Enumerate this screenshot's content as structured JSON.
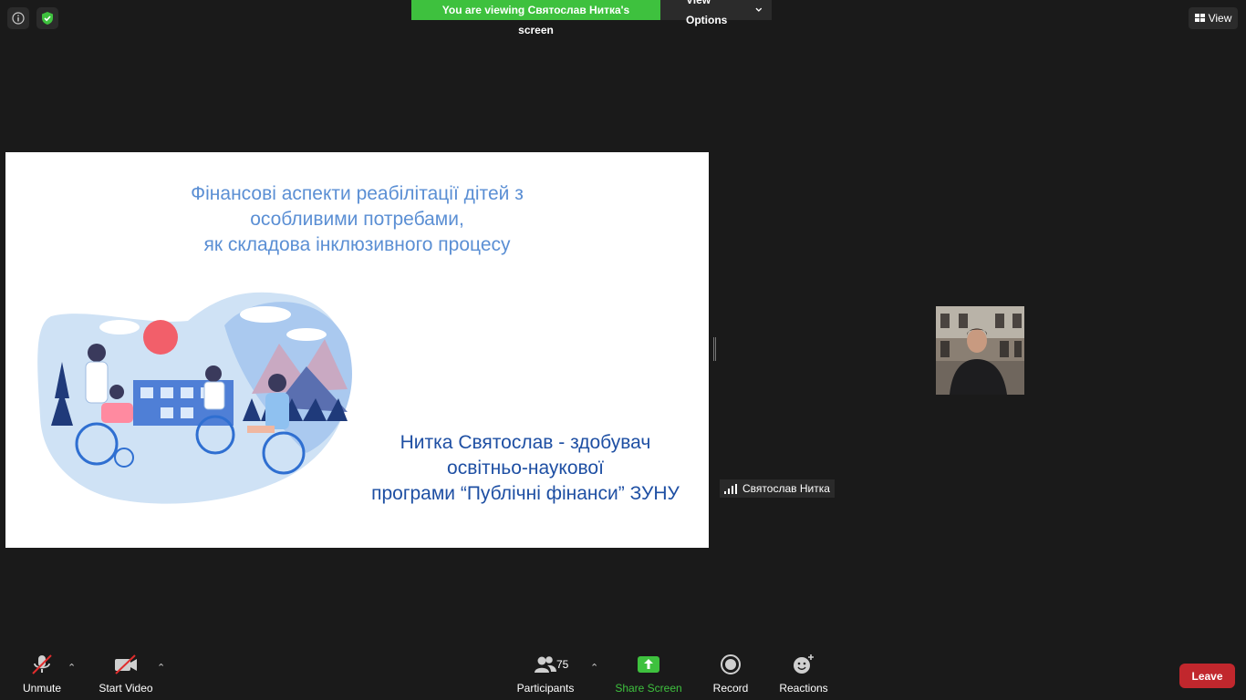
{
  "banner": {
    "viewing_text": "You are viewing Святослав Нитка's screen",
    "view_options_label": "View Options"
  },
  "top_right": {
    "view_label": "View"
  },
  "slide": {
    "title_lines": [
      "Фінансові аспекти реабілітації дітей з",
      "особливими потребами,",
      "як складова інклюзивного процесу"
    ],
    "author_lines": [
      "Нитка Святослав - здобувач",
      "освітньо-наукової",
      "програми “Публічні фінанси” ЗУНУ"
    ]
  },
  "participant": {
    "name": "Святослав Нитка"
  },
  "toolbar": {
    "unmute_label": "Unmute",
    "start_video_label": "Start Video",
    "participants_label": "Participants",
    "participants_count": "75",
    "share_screen_label": "Share Screen",
    "record_label": "Record",
    "reactions_label": "Reactions",
    "leave_label": "Leave"
  },
  "colors": {
    "accent_green": "#3ec13e",
    "leave_red": "#c1272d",
    "title_blue": "#5b8fd4",
    "author_blue": "#1e4fa3"
  }
}
